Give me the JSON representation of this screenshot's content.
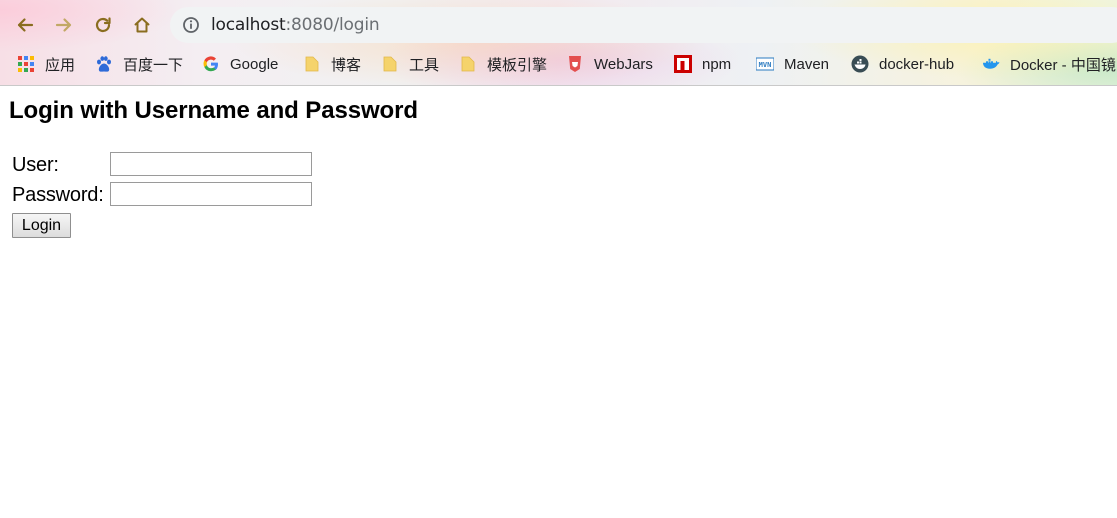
{
  "browser": {
    "url_host": "localhost",
    "url_rest": ":8080/login",
    "icons": {
      "back": "back-arrow-icon",
      "forward": "forward-arrow-icon",
      "reload": "reload-icon",
      "home": "home-icon",
      "site_info": "info-icon"
    }
  },
  "bookmarks": [
    {
      "label": "应用",
      "icon": "apps-grid-icon"
    },
    {
      "label": "百度一下",
      "icon": "baidu-paw-icon"
    },
    {
      "label": "Google",
      "icon": "google-g-icon"
    },
    {
      "label": "博客",
      "icon": "folder-icon"
    },
    {
      "label": "工具",
      "icon": "folder-icon"
    },
    {
      "label": "模板引擎",
      "icon": "folder-icon"
    },
    {
      "label": "WebJars",
      "icon": "webjars-icon"
    },
    {
      "label": "npm",
      "icon": "npm-icon"
    },
    {
      "label": "Maven",
      "icon": "maven-icon"
    },
    {
      "label": "docker-hub",
      "icon": "docker-hub-icon"
    },
    {
      "label": "Docker - 中国镜",
      "icon": "docker-whale-icon"
    }
  ],
  "page": {
    "title": "Login with Username and Password",
    "user_label": "User:",
    "user_value": "",
    "password_label": "Password:",
    "password_value": "",
    "submit_label": "Login"
  },
  "colors": {
    "nav_icon": "#8a6d1f",
    "forward_disabled": "#c2a866",
    "omnibox_bg": "#f1f3f4",
    "folder": "#f5d36b"
  }
}
